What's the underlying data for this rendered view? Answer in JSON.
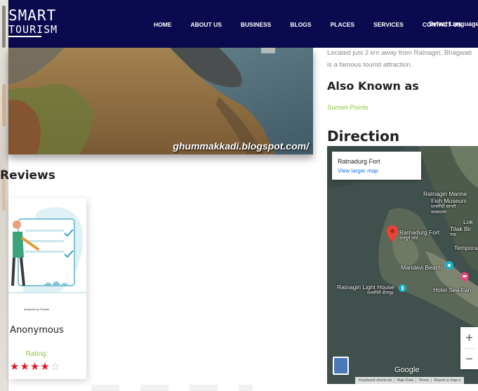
{
  "brand": {
    "line1": "SMART",
    "line2": "TOURISM"
  },
  "nav": {
    "items": [
      "HOME",
      "ABOUT US",
      "BUSINESS",
      "BLOGS",
      "PLACES",
      "SERVICES",
      "CONTACT US"
    ],
    "language": "Select Language"
  },
  "hero": {
    "watermark": "ghummakkadi.blogspot.com/"
  },
  "reviews": {
    "heading": "Reviews",
    "card": {
      "credit": "designed by Freepik",
      "name": "Anonymous",
      "rating_label": "Rating:",
      "rating": 4,
      "max_rating": 5
    }
  },
  "details": {
    "description": [
      "Located just 2 km away from Ratnagiri, Bhagwati",
      "is a famous tourist attraction."
    ],
    "aka_heading": "Also Known as",
    "aka_value": "Sunset Points",
    "direction_heading": "Direction"
  },
  "map": {
    "place_title": "Ratnadurg Fort",
    "larger_map": "View larger map",
    "labels": {
      "marine": "Ratnagiri Marine",
      "marine2": "Fish Museum",
      "marine_local": "रत्नागिरी सागरी",
      "marine_local2": "मत्स्यालय",
      "lok": "Lok",
      "tilak": "Tilak Bir",
      "tilak_local": "गाड",
      "fort": "Ratnadurg Fort",
      "fort_local": "रत्नदुर्ग फोर्ट",
      "temporary": "Temporar",
      "mandavi": "Mandavi Beach",
      "lighthouse": "Ratnagiri Light House",
      "lighthouse_local": "रत्नागिरी दीपगृह",
      "hotel": "Hotel Sea Fan"
    },
    "zoom_in": "+",
    "zoom_out": "−",
    "google": "Google",
    "attribution": [
      "Keyboard shortcuts",
      "Map Data",
      "Terms",
      "Report a map e"
    ]
  },
  "colors": {
    "nav_bg": "#0b0a4f",
    "accent_green": "#8dc63f",
    "star_red": "#e0182d",
    "link_blue": "#1a73e8"
  }
}
